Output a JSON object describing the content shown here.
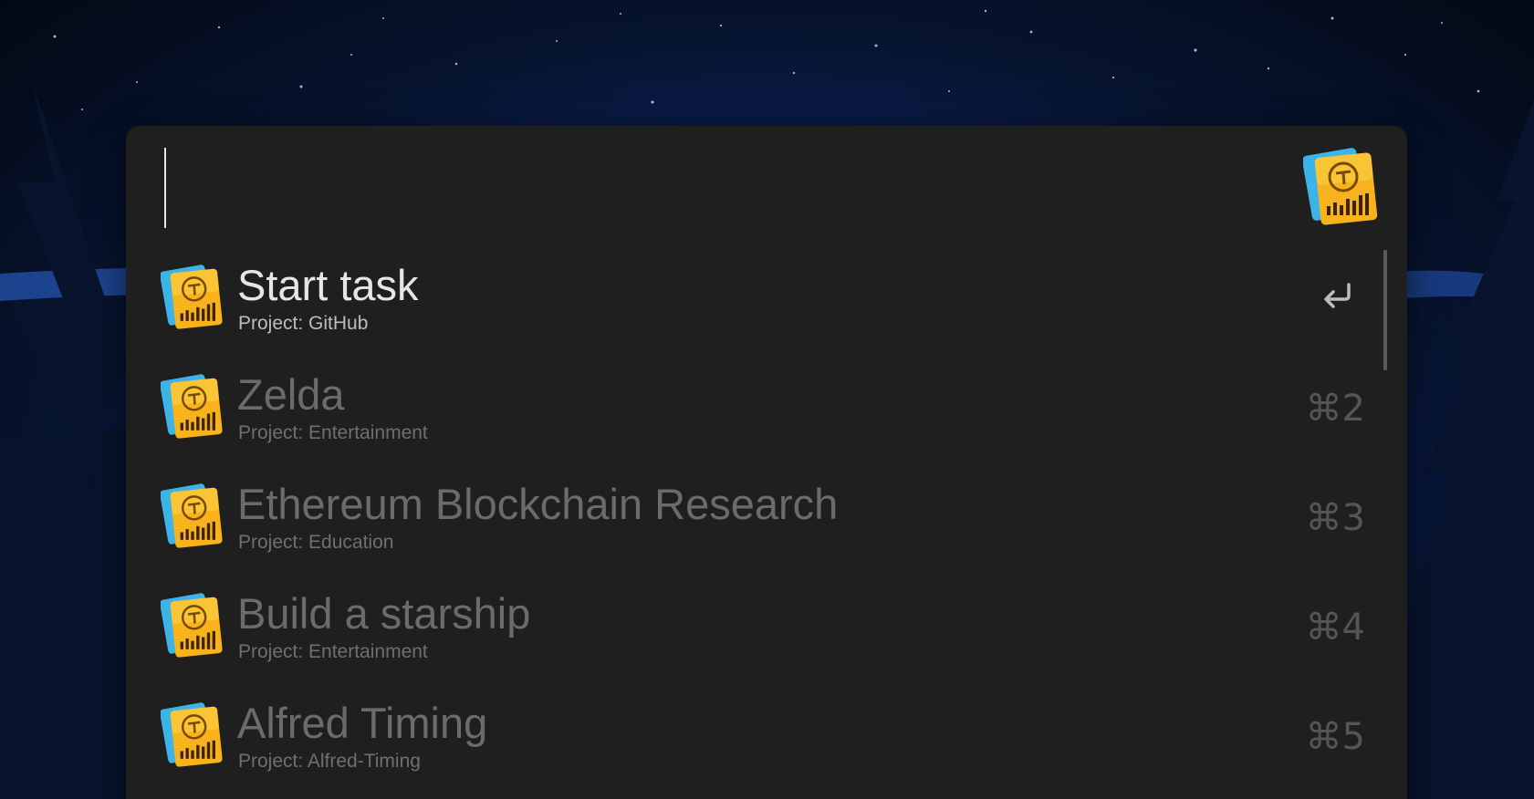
{
  "search": {
    "query": "",
    "app_icon": "alfred-timing-icon"
  },
  "results": [
    {
      "title": "Start task",
      "subtitle": "Project: GitHub",
      "shortcut": "",
      "shortcut_icon": "return-icon",
      "selected": true
    },
    {
      "title": "Zelda",
      "subtitle": "Project: Entertainment",
      "shortcut": "⌘2",
      "selected": false
    },
    {
      "title": "Ethereum Blockchain Research",
      "subtitle": "Project: Education",
      "shortcut": "⌘3",
      "selected": false
    },
    {
      "title": "Build a starship",
      "subtitle": "Project: Entertainment",
      "shortcut": "⌘4",
      "selected": false
    },
    {
      "title": "Alfred Timing",
      "subtitle": "Project: Alfred-Timing",
      "shortcut": "⌘5",
      "selected": false
    }
  ],
  "colors": {
    "panel_bg": "#1f1f1f",
    "selected_title": "#e6e6e6",
    "dim_title": "#6b6b6b",
    "icon_yellow": "#f7b21c",
    "icon_blue": "#3cb4e8"
  }
}
